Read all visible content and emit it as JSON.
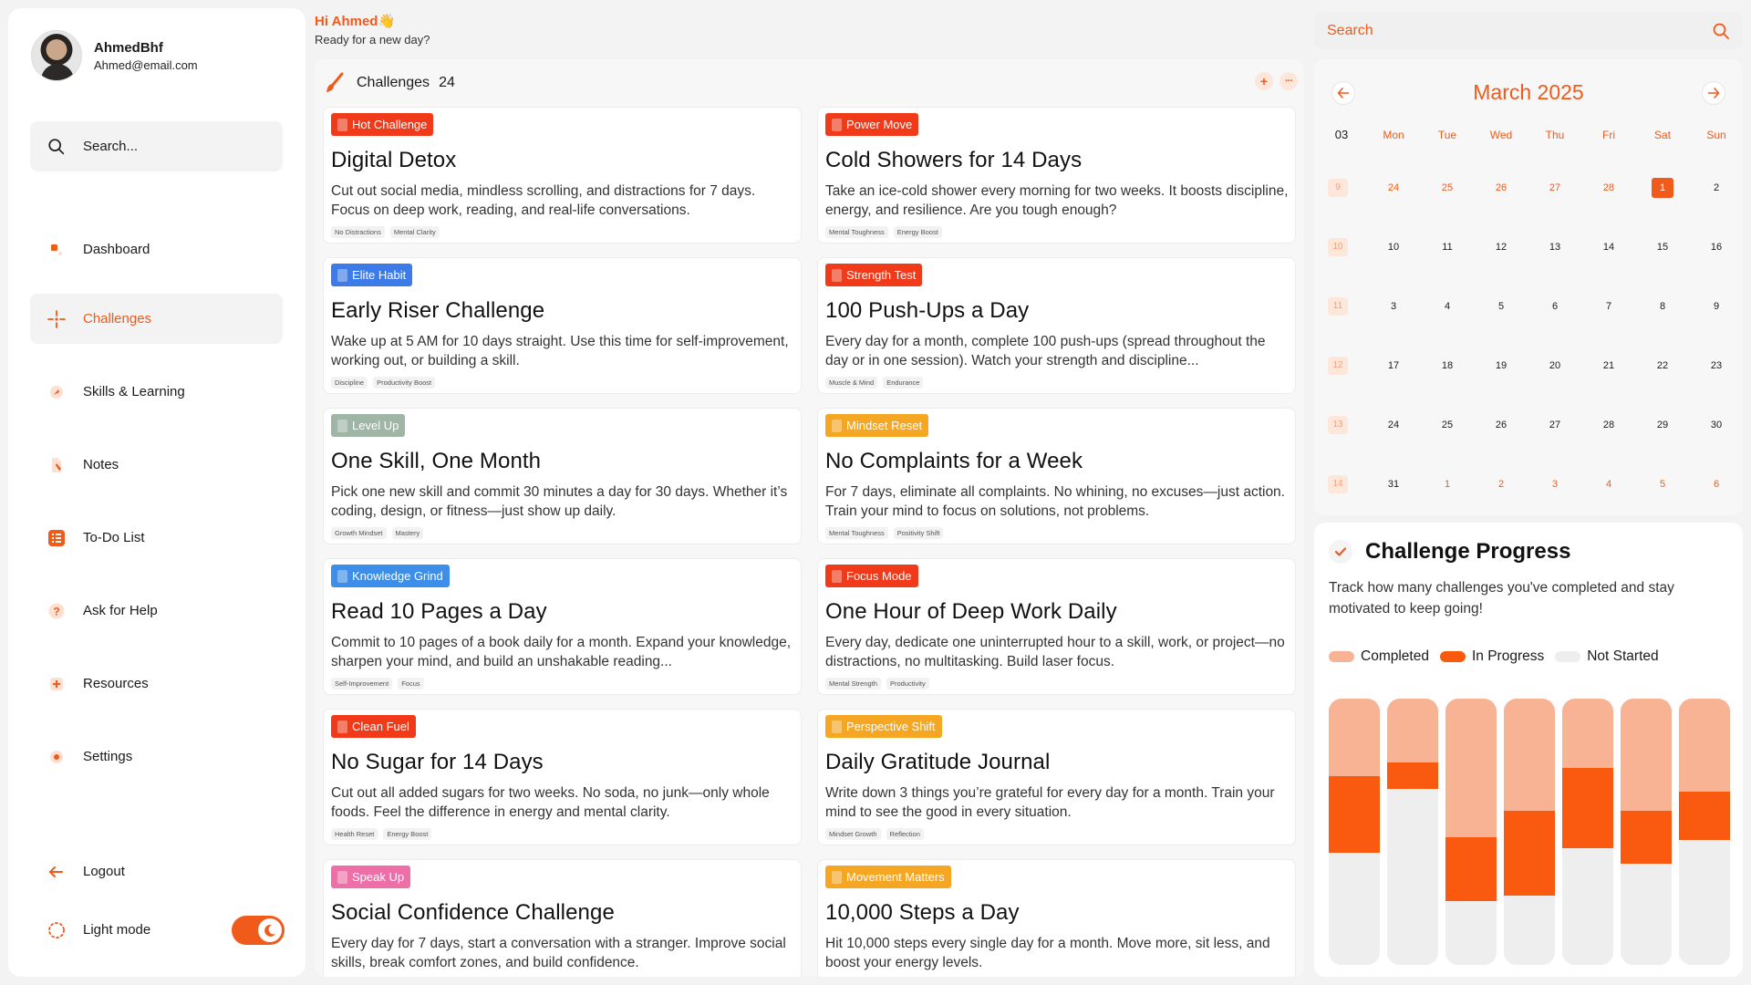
{
  "user": {
    "name": "AhmedBhf",
    "email": "Ahmed@email.com"
  },
  "sidebar": {
    "search_placeholder": "Search...",
    "items": [
      {
        "label": "Dashboard",
        "icon": "dashboard-icon"
      },
      {
        "label": "Challenges",
        "icon": "challenges-icon",
        "active": true
      },
      {
        "label": "Skills & Learning",
        "icon": "skills-icon"
      },
      {
        "label": "Notes",
        "icon": "notes-icon"
      },
      {
        "label": "To-Do List",
        "icon": "todo-list-icon"
      },
      {
        "label": "Ask for Help",
        "icon": "help-icon"
      },
      {
        "label": "Resources",
        "icon": "resources-icon"
      },
      {
        "label": "Settings",
        "icon": "settings-icon"
      }
    ],
    "logout": "Logout",
    "light_mode": "Light mode"
  },
  "greeting": {
    "hi": "Hi Ahmed👋",
    "sub": "Ready for a new day?"
  },
  "challenges": {
    "title": "Challenges",
    "count": "24",
    "cards": [
      {
        "badge": "Hot Challenge",
        "badge_color": "#f03a1a",
        "title": "Digital Detox",
        "desc": "Cut out social media, mindless scrolling, and distractions for 7 days. Focus on deep work, reading, and real-life conversations.",
        "tags": [
          "No Distractions",
          "Mental Clarity"
        ]
      },
      {
        "badge": "Power Move",
        "badge_color": "#f03a1a",
        "title": "Cold Showers for 14 Days",
        "desc": "Take an ice-cold shower every morning for two weeks. It boosts discipline, energy, and resilience. Are you tough enough?",
        "tags": [
          "Mental Toughness",
          "Energy Boost"
        ]
      },
      {
        "badge": "Elite Habit",
        "badge_color": "#3d7be8",
        "title": "Early Riser Challenge",
        "desc": "Wake up at 5 AM for 10 days straight. Use this time for self-improvement, working out, or building a skill.",
        "tags": [
          "Discipline",
          "Productivity Boost"
        ]
      },
      {
        "badge": "Strength Test",
        "badge_color": "#f03a1a",
        "title": "100 Push-Ups a Day",
        "desc": "Every day for a month, complete 100 push-ups (spread throughout the day or in one session). Watch your strength and discipline...",
        "tags": [
          "Muscle & Mind",
          "Endurance"
        ]
      },
      {
        "badge": "Level Up",
        "badge_color": "#9fb5a6",
        "title": "One Skill, One Month",
        "desc": "Pick one new skill and commit 30 minutes a day for 30 days. Whether it’s coding, design, or fitness—just show up daily.",
        "tags": [
          "Growth Mindset",
          "Mastery"
        ]
      },
      {
        "badge": "Mindset Reset",
        "badge_color": "#f5a623",
        "title": "No Complaints for a Week",
        "desc": "For 7 days, eliminate all complaints. No whining, no excuses—just action. Train your mind to focus on solutions, not problems.",
        "tags": [
          "Mental Toughness",
          "Positivity Shift"
        ]
      },
      {
        "badge": "Knowledge Grind",
        "badge_color": "#3d8ee8",
        "title": "Read 10 Pages a Day",
        "desc": "Commit to 10 pages of a book daily for a month. Expand your knowledge, sharpen your mind, and build an unshakable reading...",
        "tags": [
          "Self-Improvement",
          "Focus"
        ]
      },
      {
        "badge": "Focus Mode",
        "badge_color": "#f03a1a",
        "title": "One Hour of Deep Work Daily",
        "desc": "Every day, dedicate one uninterrupted hour to a skill, work, or project—no distractions, no multitasking. Build laser focus.",
        "tags": [
          "Mental Strength",
          "Productivity"
        ]
      },
      {
        "badge": "Clean Fuel",
        "badge_color": "#f03a1a",
        "title": "No Sugar for 14 Days",
        "desc": "Cut out all added sugars for two weeks. No soda, no junk—only whole foods. Feel the difference in energy and mental clarity.",
        "tags": [
          "Health Reset",
          "Energy Boost"
        ]
      },
      {
        "badge": "Perspective Shift",
        "badge_color": "#f5a623",
        "title": "Daily Gratitude Journal",
        "desc": "Write down 3 things you’re grateful for every day for a month. Train your mind to see the good in every situation.",
        "tags": [
          "Mindset Growth",
          "Reflection"
        ]
      },
      {
        "badge": "Speak Up",
        "badge_color": "#ee6fa8",
        "title": "Social Confidence Challenge",
        "desc": "Every day for 7 days, start a conversation with a stranger. Improve social skills, break comfort zones, and build confidence.",
        "tags": []
      },
      {
        "badge": "Movement Matters",
        "badge_color": "#f5a623",
        "title": "10,000 Steps a Day",
        "desc": "Hit 10,000 steps every single day for a month. Move more, sit less, and boost your energy levels.",
        "tags": []
      }
    ]
  },
  "search": {
    "placeholder": "Search"
  },
  "calendar": {
    "title": "March 2025",
    "corner": "03",
    "days": [
      "Mon",
      "Tue",
      "Wed",
      "Thu",
      "Fri",
      "Sat",
      "Sun"
    ],
    "weeks": [
      {
        "num": "9",
        "dates": [
          "24",
          "25",
          "26",
          "27",
          "28",
          "1",
          "2"
        ],
        "other": [
          0,
          1,
          2,
          3,
          4
        ],
        "today": 5
      },
      {
        "num": "10",
        "dates": [
          "10",
          "11",
          "12",
          "13",
          "14",
          "15",
          "16"
        ],
        "other": [],
        "today": -1
      },
      {
        "num": "11",
        "dates": [
          "3",
          "4",
          "5",
          "6",
          "7",
          "8",
          "9"
        ],
        "other": [],
        "today": -1
      },
      {
        "num": "12",
        "dates": [
          "17",
          "18",
          "19",
          "20",
          "21",
          "22",
          "23"
        ],
        "other": [],
        "today": -1
      },
      {
        "num": "13",
        "dates": [
          "24",
          "25",
          "26",
          "27",
          "28",
          "29",
          "30"
        ],
        "other": [],
        "today": -1
      },
      {
        "num": "14",
        "dates": [
          "31",
          "1",
          "2",
          "3",
          "4",
          "5",
          "6"
        ],
        "other": [
          1,
          2,
          3,
          4,
          5,
          6
        ],
        "today": -1
      }
    ]
  },
  "progress": {
    "title": "Challenge Progress",
    "desc": "Track how many challenges you've completed and stay motivated to keep going!",
    "legend": [
      {
        "label": "Completed",
        "color": "#f8b394"
      },
      {
        "label": "In Progress",
        "color": "#fa5a10"
      },
      {
        "label": "Not Started",
        "color": "#eeeeee"
      }
    ],
    "bars": [
      {
        "completed": 0.29,
        "in_progress": 0.29,
        "not_started": 0.42
      },
      {
        "completed": 0.24,
        "in_progress": 0.1,
        "not_started": 0.66
      },
      {
        "completed": 0.52,
        "in_progress": 0.24,
        "not_started": 0.24
      },
      {
        "completed": 0.42,
        "in_progress": 0.32,
        "not_started": 0.26
      },
      {
        "completed": 0.26,
        "in_progress": 0.3,
        "not_started": 0.44
      },
      {
        "completed": 0.42,
        "in_progress": 0.2,
        "not_started": 0.38
      },
      {
        "completed": 0.35,
        "in_progress": 0.18,
        "not_started": 0.47
      }
    ]
  }
}
